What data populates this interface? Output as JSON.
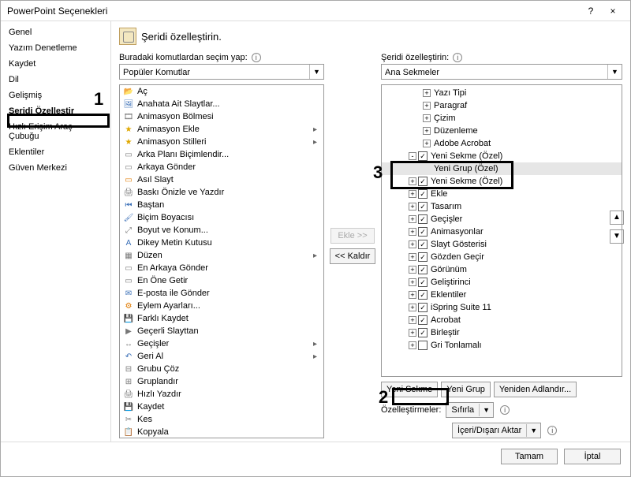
{
  "title": "PowerPoint Seçenekleri",
  "titlebar": {
    "help": "?",
    "close": "×"
  },
  "sidebar": {
    "items": [
      {
        "label": "Genel"
      },
      {
        "label": "Yazım Denetleme"
      },
      {
        "label": "Kaydet"
      },
      {
        "label": "Dil"
      },
      {
        "label": "Gelişmiş"
      },
      {
        "label": "Şeridi Özelleştir",
        "selected": true
      },
      {
        "label": "Hızlı Erişim Araç Çubuğu"
      },
      {
        "label": "Eklentiler"
      },
      {
        "label": "Güven Merkezi"
      }
    ]
  },
  "heading": "Şeridi özelleştirin.",
  "left": {
    "label": "Buradaki komutlardan seçim yap:",
    "dropdown": "Popüler Komutlar",
    "items": [
      {
        "icon": "📂",
        "cls": "ic-folder",
        "label": "Aç"
      },
      {
        "icon": "🖼",
        "cls": "ic-blue",
        "label": "Anahata Ait Slaytlar..."
      },
      {
        "icon": "🎞",
        "cls": "ic-grey",
        "label": "Animasyon Bölmesi"
      },
      {
        "icon": "★",
        "cls": "ic-star",
        "label": "Animasyon Ekle",
        "ext": "▸"
      },
      {
        "icon": "★",
        "cls": "ic-star",
        "label": "Animasyon Stilleri",
        "ext": "▸"
      },
      {
        "icon": "▭",
        "cls": "ic-grey",
        "label": "Arka Planı Biçimlendir..."
      },
      {
        "icon": "▭",
        "cls": "ic-grey",
        "label": "Arkaya Gönder"
      },
      {
        "icon": "▭",
        "cls": "ic-orange",
        "label": "Asıl Slayt"
      },
      {
        "icon": "🖨",
        "cls": "ic-grey",
        "label": "Baskı Önizle ve Yazdır"
      },
      {
        "icon": "⏮",
        "cls": "ic-blue",
        "label": "Baştan"
      },
      {
        "icon": "🖌",
        "cls": "ic-blue",
        "label": "Biçim Boyacısı"
      },
      {
        "icon": "⤢",
        "cls": "ic-grey",
        "label": "Boyut ve Konum..."
      },
      {
        "icon": "A",
        "cls": "ic-blue",
        "label": "Dikey Metin Kutusu"
      },
      {
        "icon": "▦",
        "cls": "ic-grey",
        "label": "Düzen",
        "ext": "▸"
      },
      {
        "icon": "▭",
        "cls": "ic-grey",
        "label": "En Arkaya Gönder"
      },
      {
        "icon": "▭",
        "cls": "ic-grey",
        "label": "En Öne Getir"
      },
      {
        "icon": "✉",
        "cls": "ic-blue",
        "label": "E-posta ile Gönder"
      },
      {
        "icon": "⚙",
        "cls": "ic-orange",
        "label": "Eylem Ayarları..."
      },
      {
        "icon": "💾",
        "cls": "ic-blue",
        "label": "Farklı Kaydet"
      },
      {
        "icon": "▶",
        "cls": "ic-grey",
        "label": "Geçerli Slayttan"
      },
      {
        "icon": "↔",
        "cls": "ic-grey",
        "label": "Geçişler",
        "ext": "▸"
      },
      {
        "icon": "↶",
        "cls": "ic-blue",
        "label": "Geri Al",
        "ext": "▸"
      },
      {
        "icon": "⊟",
        "cls": "ic-grey",
        "label": "Grubu Çöz"
      },
      {
        "icon": "⊞",
        "cls": "ic-grey",
        "label": "Gruplandır"
      },
      {
        "icon": "🖨",
        "cls": "ic-grey",
        "label": "Hızlı Yazdır"
      },
      {
        "icon": "💾",
        "cls": "ic-blue",
        "label": "Kaydet"
      },
      {
        "icon": "✂",
        "cls": "ic-grey",
        "label": "Kes"
      },
      {
        "icon": "📋",
        "cls": "ic-blue",
        "label": "Kopyala"
      }
    ]
  },
  "mid": {
    "add": "Ekle >>",
    "remove": "<< Kaldır"
  },
  "right": {
    "label": "Şeridi özelleştirin:",
    "dropdown": "Ana Sekmeler",
    "tree": [
      {
        "depth": 3,
        "exp": "+",
        "label": "Yazı Tipi"
      },
      {
        "depth": 3,
        "exp": "+",
        "label": "Paragraf"
      },
      {
        "depth": 3,
        "exp": "+",
        "label": "Çizim"
      },
      {
        "depth": 3,
        "exp": "+",
        "label": "Düzenleme"
      },
      {
        "depth": 3,
        "exp": "+",
        "label": "Adobe Acrobat"
      },
      {
        "depth": 2,
        "exp": "-",
        "check": true,
        "label": "Yeni Sekme (Özel)",
        "boxed3": true
      },
      {
        "depth": 3,
        "exp": "",
        "label": "Yeni Grup (Özel)",
        "selected": true
      },
      {
        "depth": 2,
        "exp": "+",
        "check": true,
        "label": "Yeni Sekme (Özel)"
      },
      {
        "depth": 2,
        "exp": "+",
        "check": true,
        "label": "Ekle"
      },
      {
        "depth": 2,
        "exp": "+",
        "check": true,
        "label": "Tasarım"
      },
      {
        "depth": 2,
        "exp": "+",
        "check": true,
        "label": "Geçişler"
      },
      {
        "depth": 2,
        "exp": "+",
        "check": true,
        "label": "Animasyonlar"
      },
      {
        "depth": 2,
        "exp": "+",
        "check": true,
        "label": "Slayt Gösterisi"
      },
      {
        "depth": 2,
        "exp": "+",
        "check": true,
        "label": "Gözden Geçir"
      },
      {
        "depth": 2,
        "exp": "+",
        "check": true,
        "label": "Görünüm"
      },
      {
        "depth": 2,
        "exp": "+",
        "check": true,
        "label": "Geliştirinci"
      },
      {
        "depth": 2,
        "exp": "+",
        "check": true,
        "label": "Eklentiler"
      },
      {
        "depth": 2,
        "exp": "+",
        "check": true,
        "label": "iSpring Suite 11"
      },
      {
        "depth": 2,
        "exp": "+",
        "check": true,
        "label": "Acrobat"
      },
      {
        "depth": 2,
        "exp": "+",
        "check": true,
        "label": "Birleştir"
      },
      {
        "depth": 2,
        "exp": "+",
        "check": false,
        "label": "Gri Tonlamalı"
      }
    ],
    "buttons": {
      "newTab": "Yeni Sekme",
      "newGroup": "Yeni Grup",
      "rename": "Yeniden Adlandır..."
    },
    "customLabel": "Özelleştirmeler:",
    "reset": "Sıfırla",
    "importExport": "İçeri/Dışarı Aktar",
    "up": "▲",
    "down": "▼"
  },
  "footer": {
    "ok": "Tamam",
    "cancel": "İptal"
  },
  "annotations": {
    "n1": "1",
    "n2": "2",
    "n3": "3"
  }
}
